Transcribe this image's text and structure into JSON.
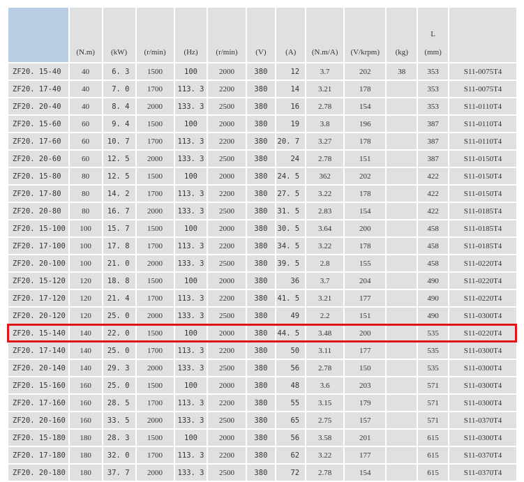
{
  "header": {
    "cols": [
      {
        "top": "",
        "unit": ""
      },
      {
        "top": "",
        "unit": "(N.m)"
      },
      {
        "top": "",
        "unit": "(kW)"
      },
      {
        "top": "",
        "unit": "(r/min)"
      },
      {
        "top": "",
        "unit": "(Hz)"
      },
      {
        "top": "",
        "unit": "(r/min)"
      },
      {
        "top": "",
        "unit": "(V)"
      },
      {
        "top": "",
        "unit": "(A)"
      },
      {
        "top": "",
        "unit": "(N.m/A)"
      },
      {
        "top": "",
        "unit": "(V/krpm)"
      },
      {
        "top": "",
        "unit": "(kg)"
      },
      {
        "top": "L",
        "unit": "(mm)"
      },
      {
        "top": "",
        "unit": ""
      }
    ]
  },
  "rows": [
    [
      "ZF20. 15-40",
      "40",
      "6. 3",
      "1500",
      "100",
      "2000",
      "380",
      "12",
      "3.7",
      "202",
      "38",
      "353",
      "S11-0075T4"
    ],
    [
      "ZF20. 17-40",
      "40",
      "7. 0",
      "1700",
      "113. 3",
      "2200",
      "380",
      "14",
      "3.21",
      "178",
      "",
      "353",
      "S11-0075T4"
    ],
    [
      "ZF20. 20-40",
      "40",
      "8. 4",
      "2000",
      "133. 3",
      "2500",
      "380",
      "16",
      "2.78",
      "154",
      "",
      "353",
      "S11-0110T4"
    ],
    [
      "ZF20. 15-60",
      "60",
      "9. 4",
      "1500",
      "100",
      "2000",
      "380",
      "19",
      "3.8",
      "196",
      "",
      "387",
      "S11-0110T4"
    ],
    [
      "ZF20. 17-60",
      "60",
      "10. 7",
      "1700",
      "113. 3",
      "2200",
      "380",
      "20. 7",
      "3.27",
      "178",
      "",
      "387",
      "S11-0110T4"
    ],
    [
      "ZF20. 20-60",
      "60",
      "12. 5",
      "2000",
      "133. 3",
      "2500",
      "380",
      "24",
      "2.78",
      "151",
      "",
      "387",
      "S11-0150T4"
    ],
    [
      "ZF20. 15-80",
      "80",
      "12. 5",
      "1500",
      "100",
      "2000",
      "380",
      "24. 5",
      "362",
      "202",
      "",
      "422",
      "S11-0150T4"
    ],
    [
      "ZF20. 17-80",
      "80",
      "14. 2",
      "1700",
      "113. 3",
      "2200",
      "380",
      "27. 5",
      "3.22",
      "178",
      "",
      "422",
      "S11-0150T4"
    ],
    [
      "ZF20. 20-80",
      "80",
      "16. 7",
      "2000",
      "133. 3",
      "2500",
      "380",
      "31. 5",
      "2.83",
      "154",
      "",
      "422",
      "S11-0185T4"
    ],
    [
      "ZF20. 15-100",
      "100",
      "15. 7",
      "1500",
      "100",
      "2000",
      "380",
      "30. 5",
      "3.64",
      "200",
      "",
      "458",
      "S11-0185T4"
    ],
    [
      "ZF20. 17-100",
      "100",
      "17. 8",
      "1700",
      "113. 3",
      "2200",
      "380",
      "34. 5",
      "3.22",
      "178",
      "",
      "458",
      "S11-0185T4"
    ],
    [
      "ZF20. 20-100",
      "100",
      "21. 0",
      "2000",
      "133. 3",
      "2500",
      "380",
      "39. 5",
      "2.8",
      "155",
      "",
      "458",
      "S11-0220T4"
    ],
    [
      "ZF20. 15-120",
      "120",
      "18. 8",
      "1500",
      "100",
      "2000",
      "380",
      "36",
      "3.7",
      "204",
      "",
      "490",
      "S11-0220T4"
    ],
    [
      "ZF20. 17-120",
      "120",
      "21. 4",
      "1700",
      "113. 3",
      "2200",
      "380",
      "41. 5",
      "3.21",
      "177",
      "",
      "490",
      "S11-0220T4"
    ],
    [
      "ZF20. 20-120",
      "120",
      "25. 0",
      "2000",
      "133. 3",
      "2500",
      "380",
      "49",
      "2.2",
      "151",
      "",
      "490",
      "S11-0300T4"
    ],
    [
      "ZF20. 15-140",
      "140",
      "22. 0",
      "1500",
      "100",
      "2000",
      "380",
      "44. 5",
      "3.48",
      "200",
      "",
      "535",
      "S11-0220T4"
    ],
    [
      "ZF20. 17-140",
      "140",
      "25. 0",
      "1700",
      "113. 3",
      "2200",
      "380",
      "50",
      "3.11",
      "177",
      "",
      "535",
      "S11-0300T4"
    ],
    [
      "ZF20. 20-140",
      "140",
      "29. 3",
      "2000",
      "133. 3",
      "2500",
      "380",
      "56",
      "2.78",
      "150",
      "",
      "535",
      "S11-0300T4"
    ],
    [
      "ZF20. 15-160",
      "160",
      "25. 0",
      "1500",
      "100",
      "2000",
      "380",
      "48",
      "3.6",
      "203",
      "",
      "571",
      "S11-0300T4"
    ],
    [
      "ZF20. 17-160",
      "160",
      "28. 5",
      "1700",
      "113. 3",
      "2200",
      "380",
      "55",
      "3.15",
      "179",
      "",
      "571",
      "S11-0300T4"
    ],
    [
      "ZF20. 20-160",
      "160",
      "33. 5",
      "2000",
      "133. 3",
      "2500",
      "380",
      "65",
      "2.75",
      "157",
      "",
      "571",
      "S11-0370T4"
    ],
    [
      "ZF20. 15-180",
      "180",
      "28. 3",
      "1500",
      "100",
      "2000",
      "380",
      "56",
      "3.58",
      "201",
      "",
      "615",
      "S11-0300T4"
    ],
    [
      "ZF20. 17-180",
      "180",
      "32. 0",
      "1700",
      "113. 3",
      "2200",
      "380",
      "62",
      "3.22",
      "177",
      "",
      "615",
      "S11-0370T4"
    ],
    [
      "ZF20. 20-180",
      "180",
      "37. 7",
      "2000",
      "133. 3",
      "2500",
      "380",
      "72",
      "2.78",
      "154",
      "",
      "615",
      "S11-0370T4"
    ]
  ],
  "highlight_row": 15,
  "highlight_color": "#e4141b"
}
